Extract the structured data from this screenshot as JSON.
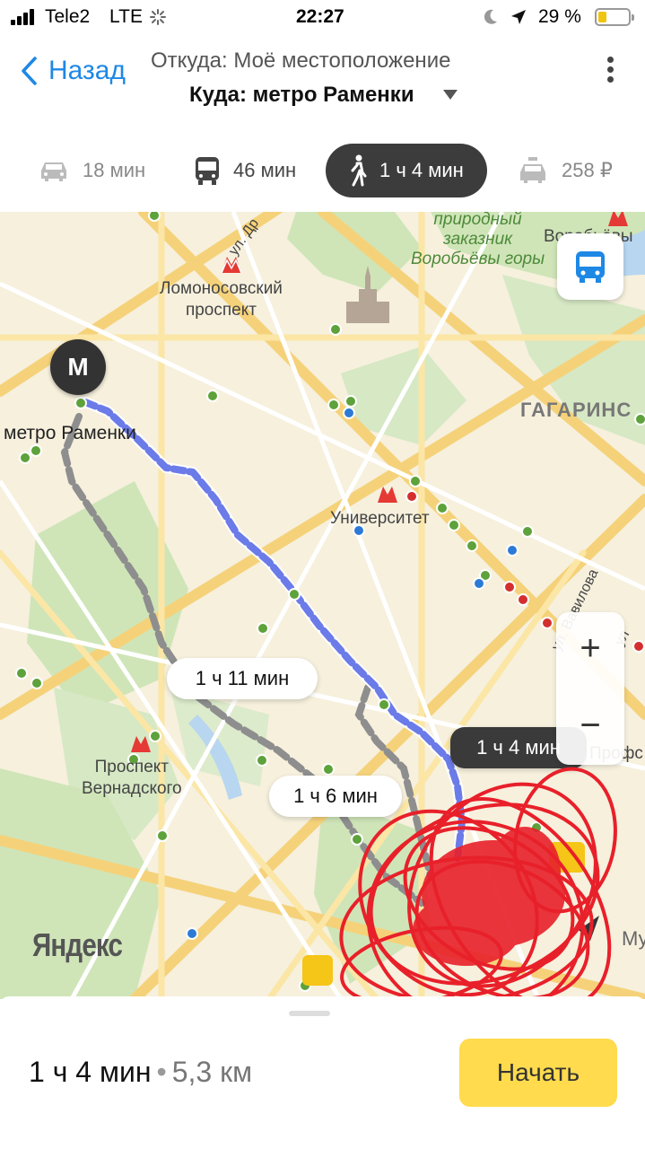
{
  "status_bar": {
    "carrier": "Tele2",
    "network": "LTE",
    "time": "22:27",
    "battery_percent": "29 %",
    "battery_level": 0.29,
    "icons": [
      "signal-icon",
      "loading-icon",
      "moon-icon",
      "location-arrow-icon",
      "battery-icon"
    ]
  },
  "header": {
    "back_label": "Назад",
    "from": "Откуда: Моё местоположение",
    "to": "Куда: метро Раменки",
    "more_icon": "more-vertical-icon"
  },
  "modes": [
    {
      "id": "car",
      "icon": "car-icon",
      "label": "18 мин",
      "active": false
    },
    {
      "id": "transit",
      "icon": "bus-icon",
      "label": "46 мин",
      "active": false
    },
    {
      "id": "walk",
      "icon": "pedestrian-icon",
      "label": "1 ч 4 мин",
      "active": true
    },
    {
      "id": "taxi",
      "icon": "taxi-icon",
      "label": "258 ₽",
      "active": false
    }
  ],
  "map": {
    "labels": {
      "lomonosov": "Ломоносовский\nпроспект",
      "ramenki": "метро Раменки",
      "universitet": "Университет",
      "vernadsky": "Проспект\nВернадского",
      "gagarinsky": "ГАГАРИНС",
      "vorobyovy": "Воробьёвы",
      "profsoyuznaya": "Профс",
      "park": "природный\nзаказник\nВоробьёвы горы",
      "street_vavilova": "ул. Вавилова",
      "street_top": "ул. Др",
      "street_right": "ул",
      "corner_right": "Му"
    },
    "destination_marker": "М",
    "route_badges": {
      "alt1": "1 ч 11 мин",
      "alt2": "1 ч 6 мин",
      "main": "1 ч 4 мин"
    },
    "zoom_in": "+",
    "zoom_out": "−",
    "logo": "Яндекс",
    "route_color": "#6b7be8",
    "alt_route_color": "#9a9a9a"
  },
  "bottom": {
    "time": "1 ч 4 мин",
    "separator": "•",
    "distance": "5,3 км",
    "start_label": "Начать",
    "start_color": "#ffdb4d"
  }
}
